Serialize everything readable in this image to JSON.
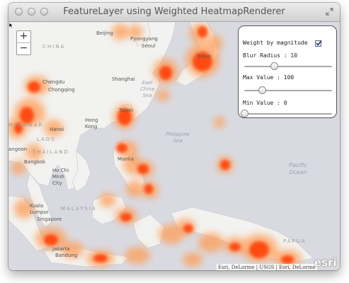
{
  "window": {
    "title": "FeatureLayer using Weighted HeatmapRenderer"
  },
  "zoom": {
    "zoom_in_label": "+",
    "zoom_out_label": "−"
  },
  "panel": {
    "weight_label": "Weight by magnitude",
    "weight_checked": true,
    "blur_label": "Blur Radius : 10",
    "blur_fraction": 0.34,
    "max_label": "Max Value : 100",
    "max_fraction": 0.2,
    "min_label": "Min Value : 0",
    "min_fraction": 0.0
  },
  "map": {
    "labels": {
      "china": "CHINA",
      "beijing": "Beijing",
      "pyongyang": "Pyongyang",
      "seoul": "Seoul",
      "tokyo": "Tokyo",
      "chengdu": "Chengdu",
      "chongqing": "Chongqing",
      "shanghai": "Shanghai",
      "east_china_sea": "East China Sea",
      "taipei": "Taipei",
      "hong_kong": "Hong Kong",
      "hanoi": "Hanoi",
      "myanmar": "MYANMAR",
      "laos": "LAOS",
      "thailand": "THAILAND",
      "rangoon": "angoon",
      "bangkok": "Bangkok",
      "ho_chi_minh": "Ho Chi Minh City",
      "philippine_sea": "Philippine Sea",
      "manila": "Manila",
      "kuala_lumpur": "Kuala Lumpur",
      "malaysia": "MALAYSIA",
      "singapore": "Singapore",
      "jakarta": "Jakarta",
      "bandung": "Bandung",
      "papua": "PAPUA",
      "pacific_ocean": "Pacific Ocean"
    },
    "attribution": "Esri, DeLorme | USGS | Esri, DeLorme",
    "logo": "esri"
  },
  "colors": {
    "heat_core": "#ff2a00",
    "heat_mid": "#ff6a00",
    "heat_edge": "#ffb070",
    "land": "#f2f2f0",
    "water": "#d9dae1"
  },
  "icons": {
    "fullscreen": "fullscreen-icon",
    "checkbox": "checkmark-icon",
    "cursor": "mouse-cursor-icon"
  }
}
